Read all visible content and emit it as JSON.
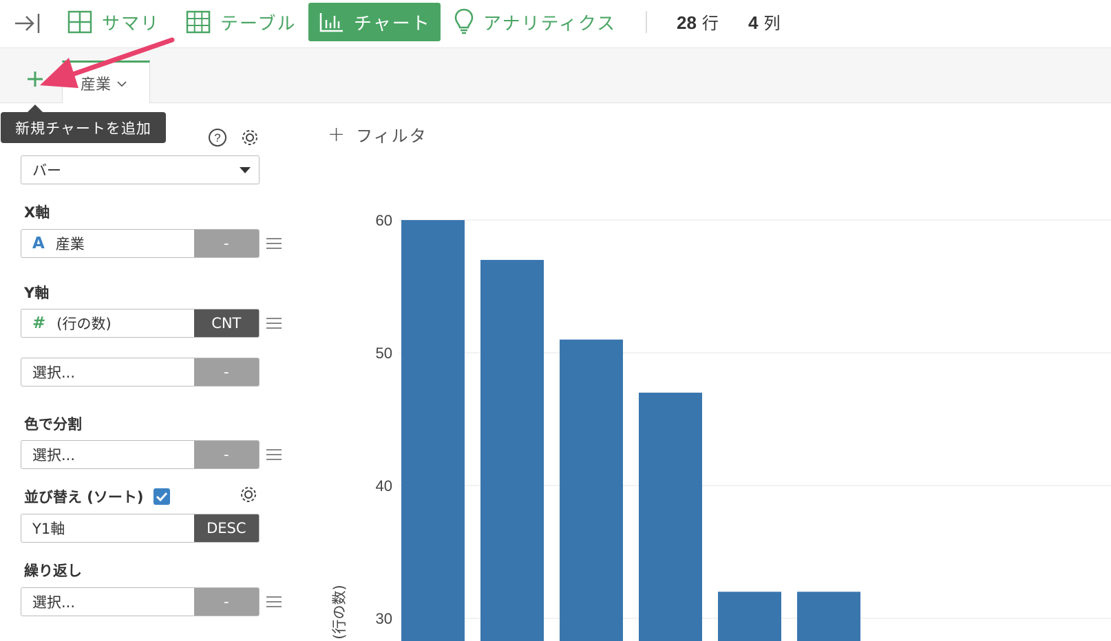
{
  "toolbar": {
    "nav": [
      {
        "label": "サマリ",
        "icon": "grid-2x2-icon",
        "active": false
      },
      {
        "label": "テーブル",
        "icon": "table-icon",
        "active": false
      },
      {
        "label": "チャート",
        "icon": "bar-chart-icon",
        "active": true
      },
      {
        "label": "アナリティクス",
        "icon": "lightbulb-icon",
        "active": false
      }
    ],
    "row_count": "28",
    "row_unit": "行",
    "col_count": "4",
    "col_unit": "列",
    "accent_color": "#4aa564"
  },
  "tabs": {
    "add_icon": "plus-icon",
    "items": [
      {
        "label": "産業"
      }
    ]
  },
  "tooltip": {
    "text": "新規チャートを追加"
  },
  "config": {
    "chart_type": {
      "value": "バー",
      "help_icon": "help-circle-icon",
      "settings_icon": "gear-icon"
    },
    "x_axis": {
      "label": "X軸",
      "field": "産業",
      "type_icon": "A",
      "agg": "-"
    },
    "y_axis": {
      "label": "Y軸",
      "field": "(行の数)",
      "type_icon": "#",
      "agg": "CNT",
      "second_field": "選択...",
      "second_agg": "-"
    },
    "color_split": {
      "label": "色で分割",
      "field": "選択...",
      "agg": "-"
    },
    "sort": {
      "label": "並び替え (ソート)",
      "checked": true,
      "field": "Y1軸",
      "order": "DESC"
    },
    "repeat": {
      "label": "繰り返し",
      "field": "選択...",
      "agg": "-"
    }
  },
  "filter": {
    "label": "フィルタ"
  },
  "chart_data": {
    "type": "bar",
    "ylabel": "(行の数)",
    "y_ticks": [
      "60",
      "50",
      "40",
      "30"
    ],
    "ylim": [
      30,
      60
    ],
    "values": [
      60,
      57,
      51,
      47,
      32,
      32
    ],
    "bar_color": "#3a76ae"
  }
}
